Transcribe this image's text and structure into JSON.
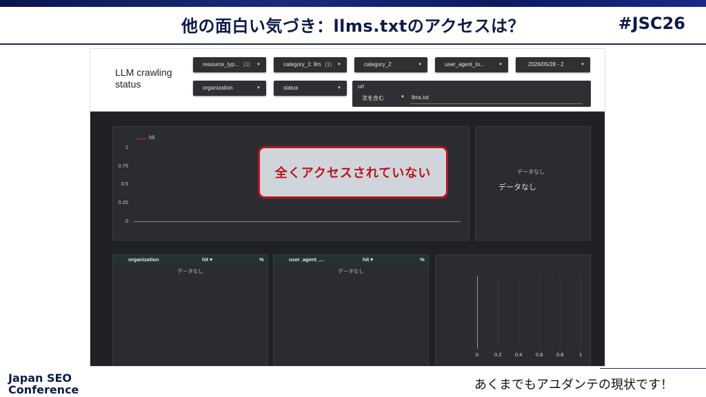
{
  "slide": {
    "title": "他の面白い気づき：llms.txtのアクセスは？",
    "hashtag": "#JSC26",
    "logo_line1": "Japan SEO",
    "logo_line2": "Conference",
    "caption": "あくまでもアユダンテの現状です！",
    "callout": "全くアクセスされていない",
    "accent_color": "#b8131e"
  },
  "report": {
    "title": "LLM crawling status",
    "filters": [
      {
        "label": "resource_typ...",
        "count": "(1)"
      },
      {
        "label": "category_1: llm",
        "count": "(1)"
      },
      {
        "label": "category_2",
        "count": ""
      },
      {
        "label": "user_agent_to...",
        "count": ""
      },
      {
        "label": "2026/05/28 - 2",
        "count": ""
      },
      {
        "label": "organization",
        "count": ""
      },
      {
        "label": "status",
        "count": ""
      }
    ],
    "url_filter": {
      "label": "url",
      "operator": "次を含む",
      "value": "llms.txt"
    },
    "line_chart": {
      "legend": "hit",
      "yticks": [
        "1",
        "0.75",
        "0.5",
        "0.25",
        "0"
      ]
    },
    "pie_panel": {
      "nodata_small": "データなし",
      "nodata_large": "データなし"
    },
    "table1": {
      "col1": "organization",
      "col2": "hit ▾",
      "col3": "%",
      "nodata": "データなし"
    },
    "table2": {
      "col1": "user_agent_...",
      "col2": "hit ▾",
      "col3": "%",
      "nodata": "データなし"
    },
    "bar_chart": {
      "xticks": [
        "0",
        "0.2",
        "0.4",
        "0.6",
        "0.8",
        "1"
      ]
    }
  }
}
